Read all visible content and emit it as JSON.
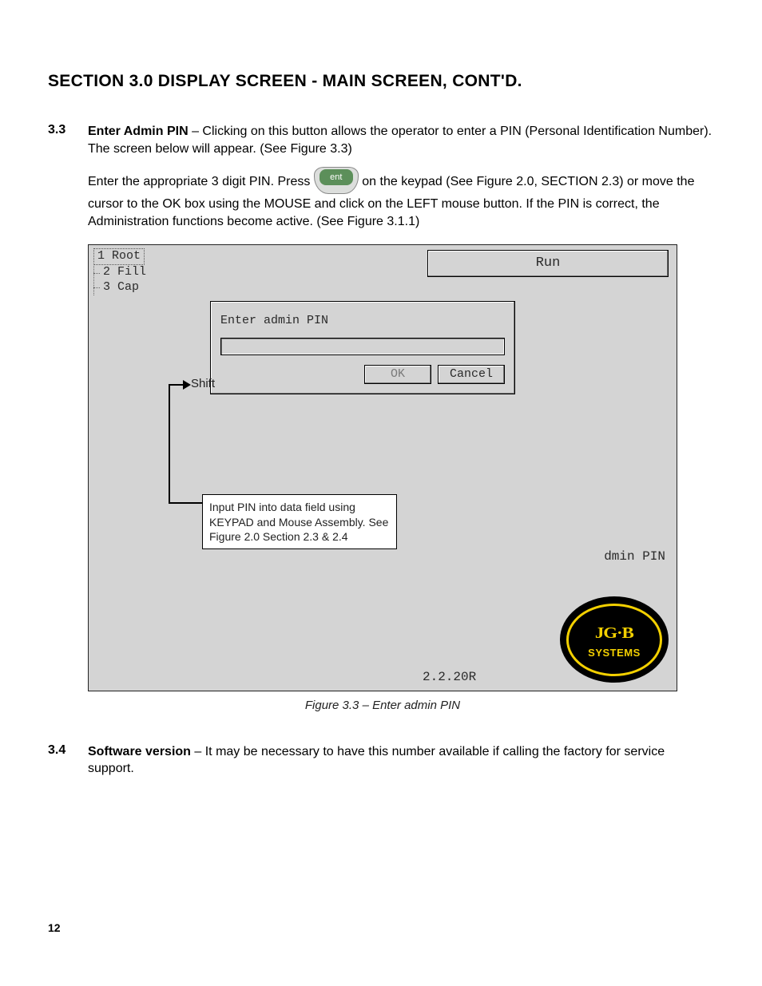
{
  "section_title": "SECTION 3.0 DISPLAY SCREEN - MAIN SCREEN, CONT'D.",
  "entries": [
    {
      "num": "3.3",
      "lead": "Enter Admin PIN",
      "para1": " – Clicking on this button allows the operator to enter a PIN (Personal Identification Number). The screen below will appear. (See Figure 3.3)",
      "para2_pre": "Enter the appropriate 3 digit PIN. Press ",
      "key_label": "ent",
      "para2_post": " on the keypad (See Figure 2.0, SECTION 2.3) or move the cursor to the OK box using the MOUSE and click on the LEFT mouse button. If the PIN is correct, the Administration functions become active. (See Figure 3.1.1)"
    },
    {
      "num": "3.4",
      "lead": "Software version",
      "para1": " – It may be necessary to have this number available if calling the factory for service support."
    }
  ],
  "figure": {
    "tree": {
      "root": "1 Root",
      "row2": "2 Fill",
      "row3": "3 Cap"
    },
    "run_button": "Run",
    "dialog": {
      "label": "Enter admin PIN",
      "input_value": "",
      "ok": "OK",
      "cancel": "Cancel"
    },
    "shift_label": "Shift",
    "callout": "Input PIN into data field using KEYPAD and Mouse Assembly. See Figure 2.0 Section 2.3 & 2.4",
    "admin_pin_text": "dmin PIN",
    "version": "2.2.20R",
    "logo": {
      "top": "JG·B",
      "bottom": "SYSTEMS"
    },
    "caption": "Figure 3.3 – Enter admin PIN"
  },
  "page_num": "12"
}
